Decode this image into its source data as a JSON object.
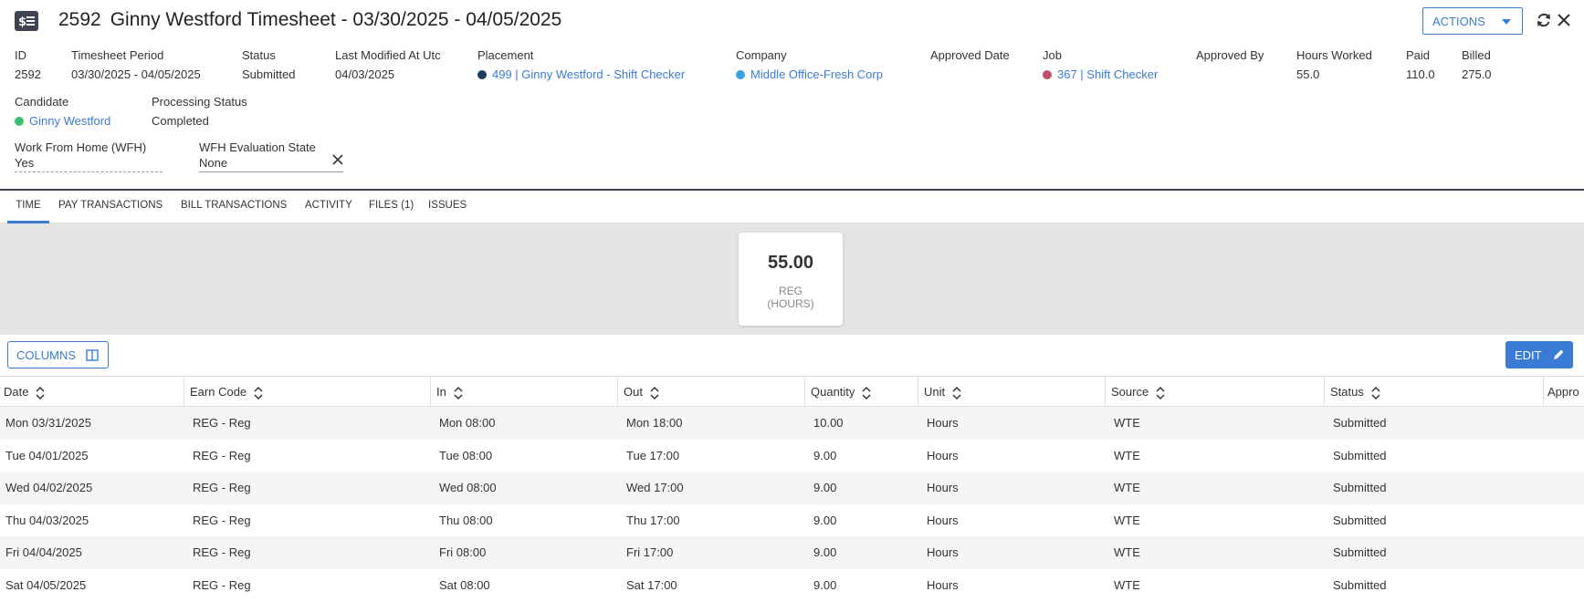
{
  "header": {
    "id": "2592",
    "title": "Ginny Westford Timesheet - 03/30/2025 - 04/05/2025",
    "actions_label": "ACTIONS"
  },
  "fields": {
    "id_label": "ID",
    "id_value": "2592",
    "period_label": "Timesheet Period",
    "period_value": "03/30/2025 - 04/05/2025",
    "status_label": "Status",
    "status_value": "Submitted",
    "modified_label": "Last Modified At Utc",
    "modified_value": "04/03/2025",
    "placement_label": "Placement",
    "placement_value": "499 | Ginny Westford - Shift Checker",
    "company_label": "Company",
    "company_value": "Middle Office-Fresh Corp",
    "approved_date_label": "Approved Date",
    "job_label": "Job",
    "job_value": "367 | Shift Checker",
    "approved_by_label": "Approved By",
    "hours_label": "Hours Worked",
    "hours_value": "55.0",
    "paid_label": "Paid",
    "paid_value": "110.0",
    "billed_label": "Billed",
    "billed_value": "275.0",
    "candidate_label": "Candidate",
    "candidate_value": "Ginny Westford",
    "processing_label": "Processing Status",
    "processing_value": "Completed",
    "wfh_label": "Work From Home (WFH)",
    "wfh_value": "Yes",
    "wfh_eval_label": "WFH Evaluation State",
    "wfh_eval_value": "None"
  },
  "colors": {
    "placement_dot": "#1f3a5a",
    "company_dot": "#3aa0e0",
    "job_dot": "#c0506a",
    "candidate_dot": "#3cc070",
    "accent": "#3a7bd5"
  },
  "tabs": [
    {
      "label": "TIME"
    },
    {
      "label": "PAY TRANSACTIONS"
    },
    {
      "label": "BILL TRANSACTIONS"
    },
    {
      "label": "ACTIVITY"
    },
    {
      "label": "FILES (1)"
    },
    {
      "label": "ISSUES"
    }
  ],
  "summary": {
    "value": "55.00",
    "caption_line1": "REG",
    "caption_line2": "(HOURS)"
  },
  "toolbar": {
    "columns_label": "COLUMNS",
    "edit_label": "EDIT"
  },
  "table": {
    "columns": [
      "Date",
      "Earn Code",
      "In",
      "Out",
      "Quantity",
      "Unit",
      "Source",
      "Status",
      "Appro"
    ],
    "rows": [
      [
        "Mon 03/31/2025",
        "REG - Reg",
        "Mon 08:00",
        "Mon 18:00",
        "10.00",
        "Hours",
        "WTE",
        "Submitted"
      ],
      [
        "Tue 04/01/2025",
        "REG - Reg",
        "Tue 08:00",
        "Tue 17:00",
        "9.00",
        "Hours",
        "WTE",
        "Submitted"
      ],
      [
        "Wed 04/02/2025",
        "REG - Reg",
        "Wed 08:00",
        "Wed 17:00",
        "9.00",
        "Hours",
        "WTE",
        "Submitted"
      ],
      [
        "Thu 04/03/2025",
        "REG - Reg",
        "Thu 08:00",
        "Thu 17:00",
        "9.00",
        "Hours",
        "WTE",
        "Submitted"
      ],
      [
        "Fri 04/04/2025",
        "REG - Reg",
        "Fri 08:00",
        "Fri 17:00",
        "9.00",
        "Hours",
        "WTE",
        "Submitted"
      ],
      [
        "Sat 04/05/2025",
        "REG - Reg",
        "Sat 08:00",
        "Sat 17:00",
        "9.00",
        "Hours",
        "WTE",
        "Submitted"
      ]
    ]
  }
}
